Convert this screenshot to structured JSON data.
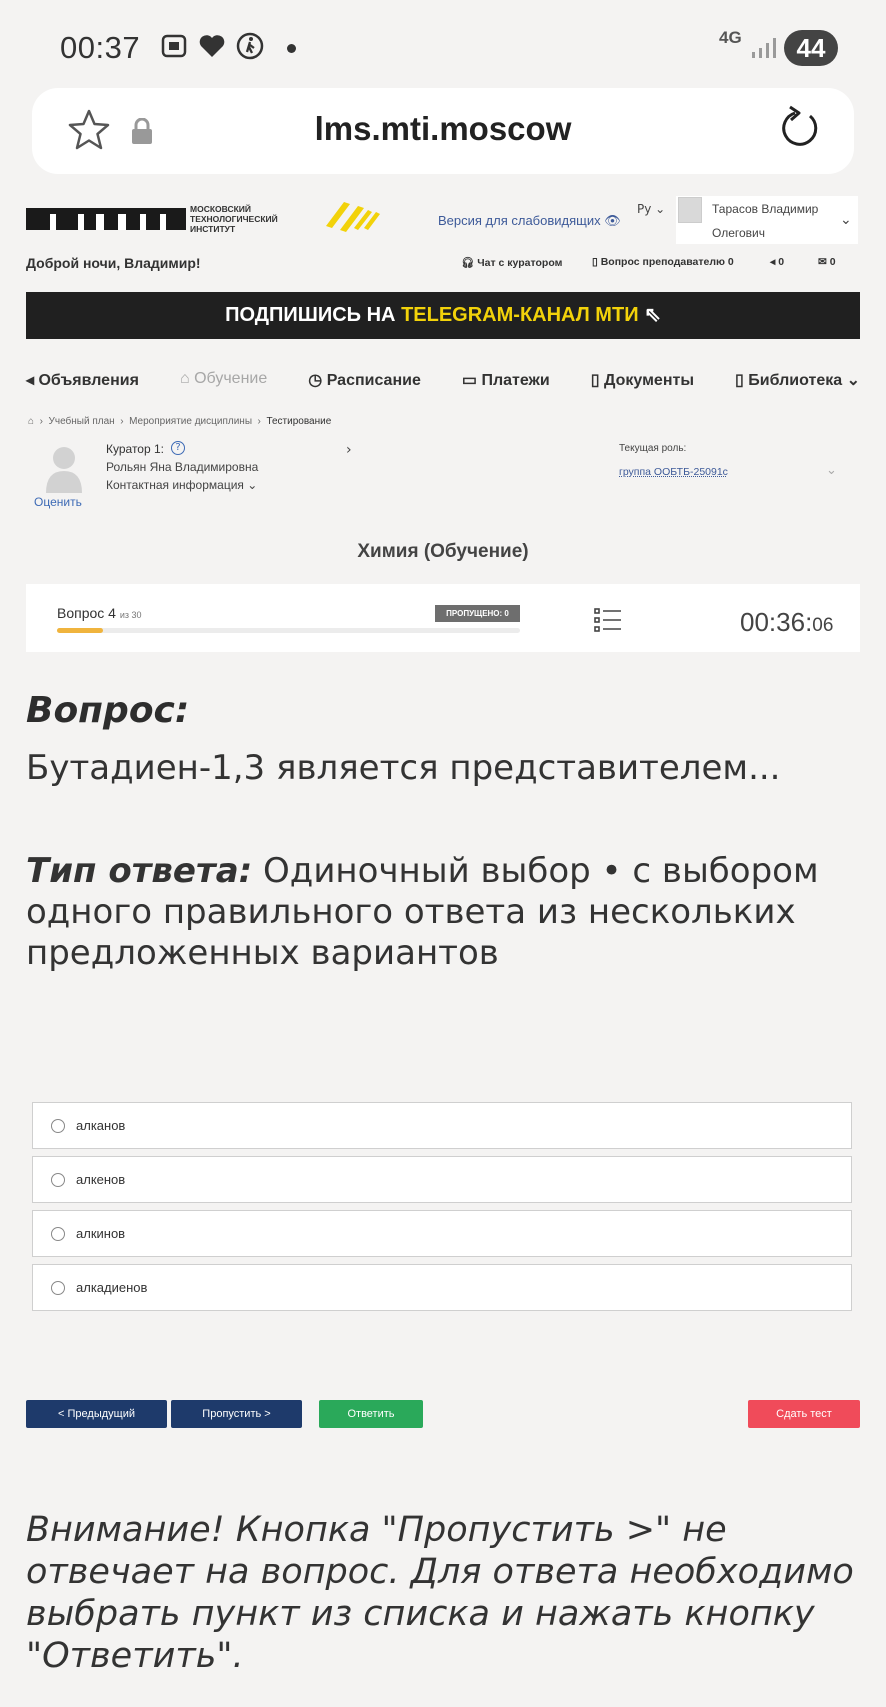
{
  "status_bar": {
    "time": "00:37",
    "network": "4G",
    "battery": "44"
  },
  "browser": {
    "url": "lms.mti.moscow"
  },
  "header": {
    "logo_text": "МТИ",
    "logo_sub_1": "МОСКОВСКИЙ",
    "logo_sub_2": "ТЕХНОЛОГИЧЕСКИЙ",
    "logo_sub_3": "ИНСТИТУТ",
    "accessibility_link": "Версия для слабовидящих",
    "language": "Ру",
    "user_name_line1": "Тарасов Владимир",
    "user_name_line2": "Олегович",
    "greeting": "Доброй ночи, Владимир!",
    "chat_curator": "Чат с куратором",
    "question_teacher": "Вопрос преподавателю 0",
    "announcements_count": "0",
    "messages_count": "0"
  },
  "banner": {
    "text_before": "ПОДПИШИСЬ НА ",
    "highlight": "TELEGRAM-КАНАЛ МТИ"
  },
  "nav": {
    "announcements": "Объявления",
    "learning": "Обучение",
    "schedule": "Расписание",
    "payments": "Платежи",
    "documents": "Документы",
    "library": "Библиотека"
  },
  "breadcrumbs": [
    "Учебный план",
    "Мероприятие дисциплины",
    "Тестирование"
  ],
  "curator": {
    "label": "Куратор 1:",
    "name": "Рольян Яна Владимировна",
    "contact": "Контактная информация",
    "rate": "Оценить"
  },
  "role": {
    "label": "Текущая роль:",
    "value": "группа ООБТБ-25091с"
  },
  "subject": "Химия (Обучение)",
  "progress": {
    "question_label": "Вопрос 4",
    "of_total": "из 30",
    "skipped": "ПРОПУЩЕНО: 0",
    "fraction": 0.1,
    "timer_main": "00:36:",
    "timer_sec": "06"
  },
  "question": {
    "title": "Вопрос:",
    "text": "Бутадиен-1,3 является представителем...",
    "answer_type_label": "Тип ответа:",
    "answer_type_text": "Одиночный выбор • с выбором одного правильного ответа из нескольких предложенных вариантов"
  },
  "options": [
    "алканов",
    "алкенов",
    "алкинов",
    "алкадиенов"
  ],
  "buttons": {
    "prev": "< Предыдущий",
    "skip": "Пропустить >",
    "answer": "Ответить",
    "submit": "Сдать тест"
  },
  "warning": "Внимание! Кнопка \"Пропустить >\" не отвечает на вопрос. Для ответа необходимо выбрать пункт из списка и нажать кнопку \"Ответить\"."
}
